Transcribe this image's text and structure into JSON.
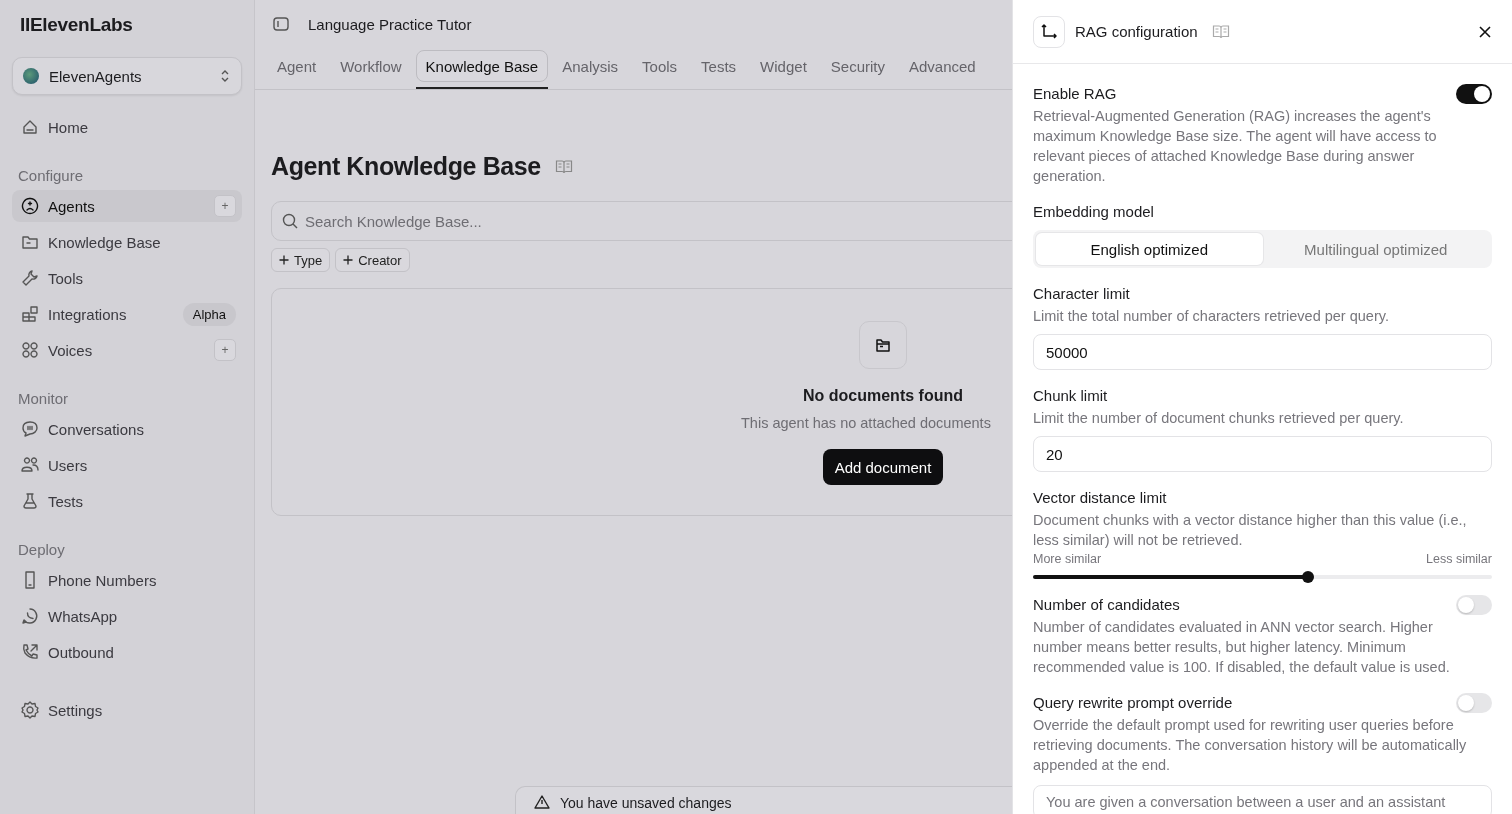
{
  "sidebar": {
    "logo": "IIElevenLabs",
    "workspace": {
      "name": "ElevenAgents"
    },
    "sections": [
      {
        "items": [
          {
            "label": "Home",
            "selected": false
          }
        ]
      },
      {
        "title": "Configure",
        "items": [
          {
            "label": "Agents",
            "selected": true,
            "action": "+"
          },
          {
            "label": "Knowledge Base",
            "selected": false
          },
          {
            "label": "Tools",
            "selected": false
          },
          {
            "label": "Integrations",
            "selected": false,
            "badge": "Alpha"
          },
          {
            "label": "Voices",
            "selected": false,
            "action": "+"
          }
        ]
      },
      {
        "title": "Monitor",
        "items": [
          {
            "label": "Conversations",
            "selected": false
          },
          {
            "label": "Users",
            "selected": false
          },
          {
            "label": "Tests",
            "selected": false
          }
        ]
      },
      {
        "title": "Deploy",
        "items": [
          {
            "label": "Phone Numbers",
            "selected": false
          },
          {
            "label": "WhatsApp",
            "selected": false
          },
          {
            "label": "Outbound",
            "selected": false
          }
        ]
      },
      {
        "items": [
          {
            "label": "Settings",
            "selected": false
          }
        ]
      }
    ]
  },
  "header": {
    "title": "Language Practice Tutor"
  },
  "tabs": [
    {
      "label": "Agent",
      "selected": false
    },
    {
      "label": "Workflow",
      "selected": false
    },
    {
      "label": "Knowledge Base",
      "selected": true
    },
    {
      "label": "Analysis",
      "selected": false
    },
    {
      "label": "Tools",
      "selected": false
    },
    {
      "label": "Tests",
      "selected": false
    },
    {
      "label": "Widget",
      "selected": false
    },
    {
      "label": "Security",
      "selected": false
    },
    {
      "label": "Advanced",
      "selected": false
    }
  ],
  "knowledge_base": {
    "title": "Agent Knowledge Base",
    "search": {
      "placeholder": "Search Knowledge Base..."
    },
    "filters": [
      "Type",
      "Creator"
    ],
    "empty_state": {
      "title": "No documents found",
      "description": "This agent has no attached documents",
      "button": "Add document"
    },
    "unsaved_notice": "You have unsaved changes"
  },
  "panel": {
    "title": "RAG configuration",
    "settings": [
      {
        "kind": "toggle",
        "label": "Enable RAG",
        "description": "Retrieval-Augmented Generation (RAG) increases the agent's maximum Knowledge Base size. The agent will have access to relevant pieces of attached Knowledge Base during answer generation.",
        "on": true
      },
      {
        "kind": "segmented",
        "label": "Embedding model",
        "options": [
          {
            "label": "English optimized",
            "selected": true
          },
          {
            "label": "Multilingual optimized",
            "selected": false
          }
        ]
      },
      {
        "kind": "number",
        "label": "Character limit",
        "description": "Limit the total number of characters retrieved per query.",
        "value": "50000"
      },
      {
        "kind": "number",
        "label": "Chunk limit",
        "description": "Limit the number of document chunks retrieved per query.",
        "value": "20"
      },
      {
        "kind": "slider",
        "label": "Vector distance limit",
        "description": "Document chunks with a vector distance higher than this value (i.e., less similar) will not be retrieved.",
        "min_label": "More similar",
        "max_label": "Less similar",
        "level": 0.6
      },
      {
        "kind": "toggle",
        "label": "Number of candidates",
        "description": "Number of candidates evaluated in ANN vector search. Higher number means better results, but higher latency. Minimum recommended value is 100. If disabled, the default value is used.",
        "on": false
      },
      {
        "kind": "toggle",
        "label": "Query rewrite prompt override",
        "description": "Override the default prompt used for rewriting user queries before retrieving documents. The conversation history will be automatically appended at the end.",
        "on": false,
        "field_value": "You are given a conversation between a user and an assistant"
      }
    ]
  }
}
